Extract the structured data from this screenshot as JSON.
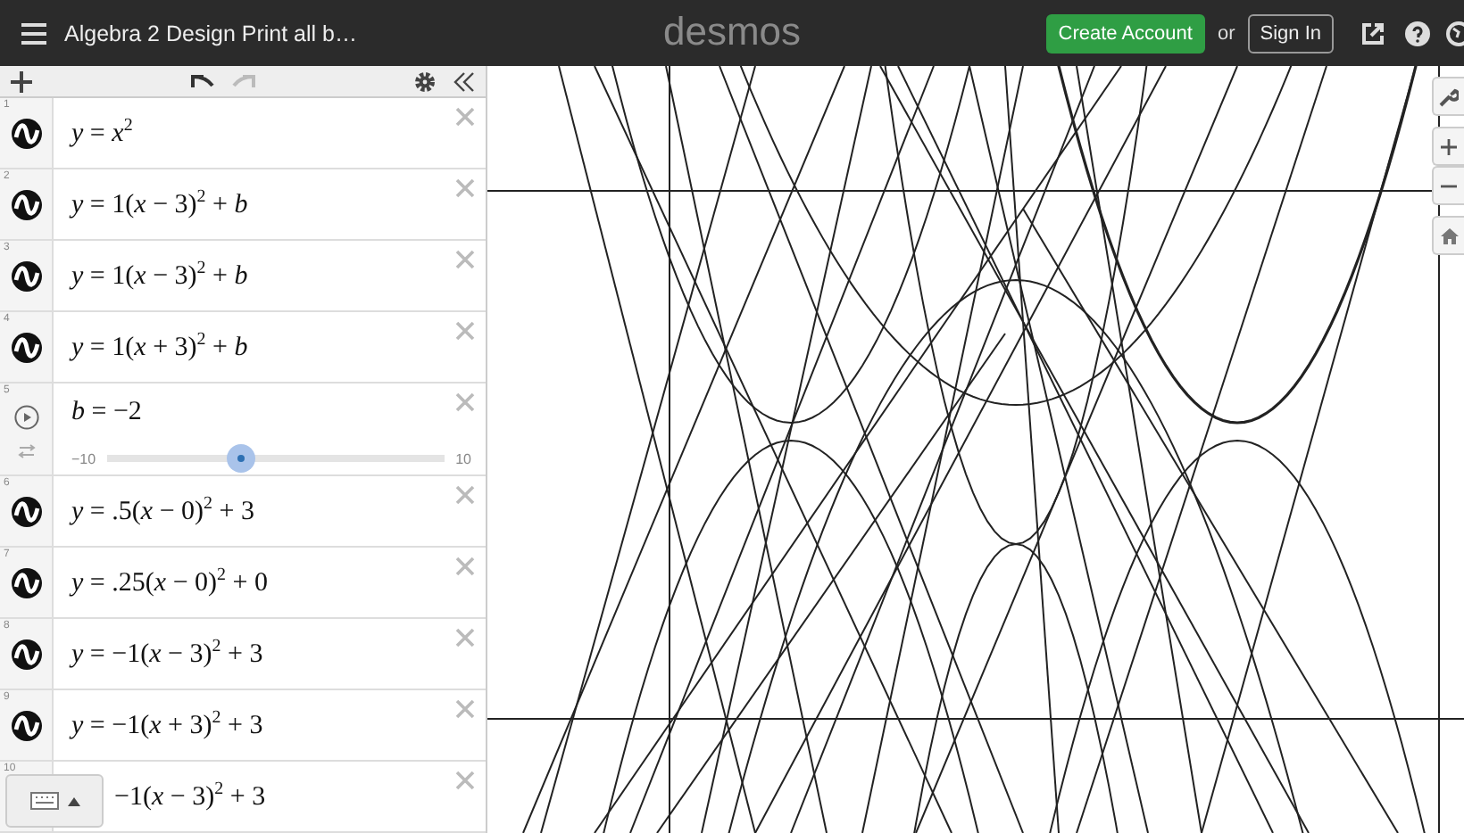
{
  "header": {
    "title": "Algebra 2 Design Print all b…",
    "logo": "desmos",
    "create_account": "Create Account",
    "or": "or",
    "sign_in": "Sign In"
  },
  "expressions": [
    {
      "kind": "expression",
      "number": "1",
      "latex": "*y* = *x*$^{2}$"
    },
    {
      "kind": "expression",
      "number": "2",
      "latex": "*y* = 1(*x* − 3)$^{2}$ + *b*"
    },
    {
      "kind": "expression",
      "number": "3",
      "latex": "*y* = 1(*x* − 3)$^{2}$ + *b*"
    },
    {
      "kind": "expression",
      "number": "4",
      "latex": "*y* = 1(*x* + 3)$^{2}$ + *b*"
    },
    {
      "kind": "slider",
      "number": "5",
      "latex": "*b* = −2",
      "min": "−10",
      "max": "10",
      "level": 0.4
    },
    {
      "kind": "expression",
      "number": "6",
      "latex": "*y* = .5(*x* − 0)$^{2}$ + 3"
    },
    {
      "kind": "expression",
      "number": "7",
      "latex": "*y* = .25(*x* − 0)$^{2}$ + 0"
    },
    {
      "kind": "expression",
      "number": "8",
      "latex": "*y* = −1(*x* − 3)$^{2}$ + 3"
    },
    {
      "kind": "expression",
      "number": "9",
      "latex": "*y* = −1(*x* + 3)$^{2}$ + 3"
    },
    {
      "kind": "partial",
      "number": "10",
      "latex": "−1(*x* − 3)$^{2}$ + 3"
    }
  ]
}
